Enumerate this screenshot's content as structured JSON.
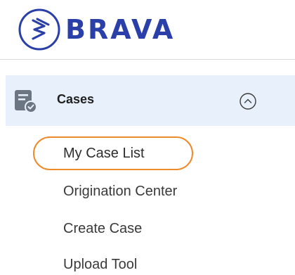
{
  "brand": {
    "name": "BRAVA",
    "logo_icon": "brava-logo-icon",
    "color": "#2b3fa8"
  },
  "nav": {
    "section": {
      "label": "Cases",
      "icon": "cases-icon",
      "toggle_icon": "chevron-up-icon",
      "expanded": true
    },
    "items": [
      {
        "label": "My Case List",
        "highlighted": true
      },
      {
        "label": "Origination Center"
      },
      {
        "label": "Create Case"
      },
      {
        "label": "Upload Tool"
      }
    ]
  },
  "colors": {
    "section_bg": "#e8f1fb",
    "highlight": "#ef8a2a",
    "text": "#3a3a3a"
  }
}
